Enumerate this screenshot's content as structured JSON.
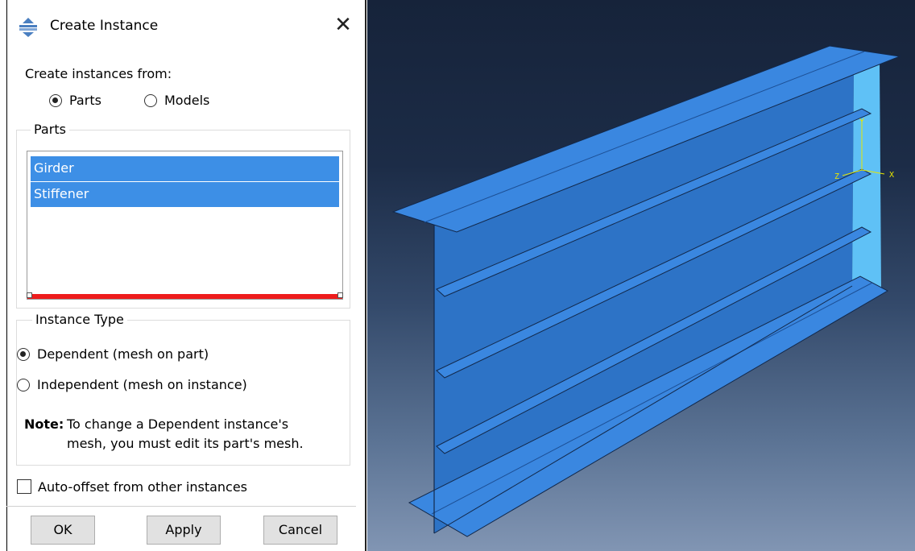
{
  "dialog": {
    "title": "Create Instance",
    "close_glyph": "✕",
    "source_label": "Create instances from:",
    "source_options": [
      {
        "label": "Parts",
        "selected": true
      },
      {
        "label": "Models",
        "selected": false
      }
    ],
    "parts_group_label": "Parts",
    "parts": [
      {
        "label": "Girder",
        "selected": true
      },
      {
        "label": "Stiffener",
        "selected": true
      }
    ],
    "instance_type_label": "Instance Type",
    "instance_types": [
      {
        "label": "Dependent (mesh on part)",
        "selected": true
      },
      {
        "label": "Independent (mesh on instance)",
        "selected": false
      }
    ],
    "note_label": "Note:",
    "note_line1": "To change a Dependent instance's",
    "note_line2": "mesh, you must edit its part's mesh.",
    "auto_offset_label": "Auto-offset from other instances",
    "auto_offset_checked": false,
    "buttons": {
      "ok": "OK",
      "apply": "Apply",
      "cancel": "Cancel"
    }
  },
  "viewport": {
    "axes": {
      "x": "X",
      "y": "Y",
      "z": "Z"
    },
    "colors": {
      "part_face": "#3a87e0",
      "part_shade": "#2a6fc4",
      "part_light": "#5fc1f6",
      "selection_bar": "#ee1c1c",
      "list_highlight": "#3d8fe6",
      "triad": "#e6e600"
    }
  }
}
